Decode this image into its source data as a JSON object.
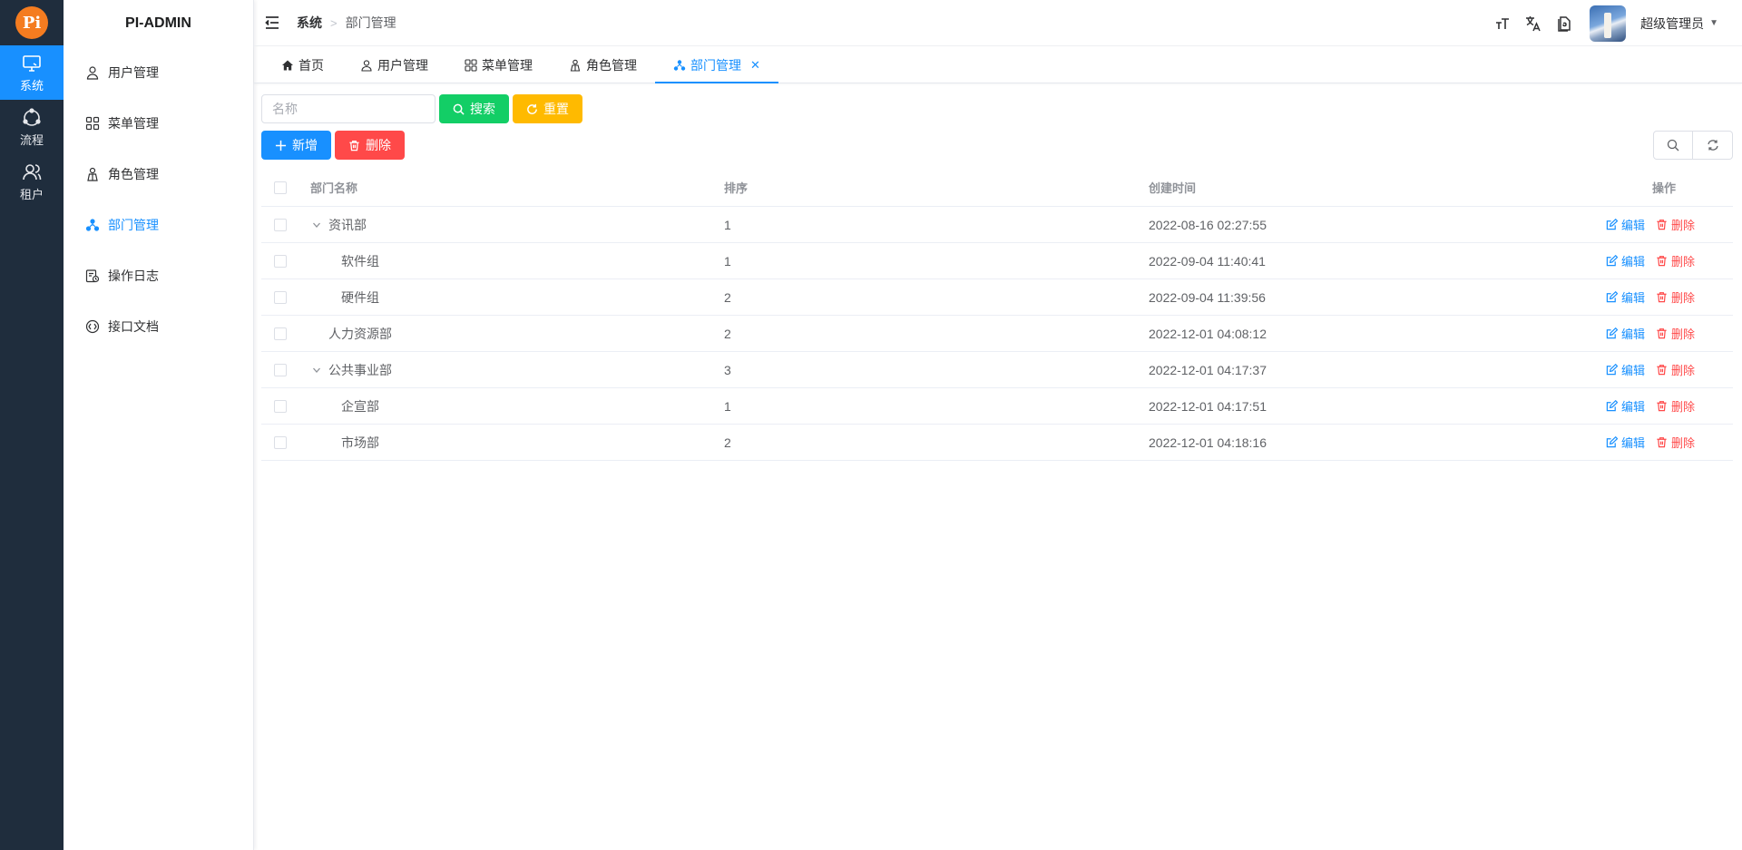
{
  "app": {
    "logo_text": "Pi",
    "brand": "PI-ADMIN"
  },
  "rail": [
    {
      "label": "系统",
      "icon": "monitor-icon",
      "active": true
    },
    {
      "label": "流程",
      "icon": "flow-icon",
      "active": false
    },
    {
      "label": "租户",
      "icon": "users-icon",
      "active": false
    }
  ],
  "menu": [
    {
      "label": "用户管理",
      "icon": "user-icon",
      "active": false
    },
    {
      "label": "菜单管理",
      "icon": "grid-icon",
      "active": false
    },
    {
      "label": "角色管理",
      "icon": "role-icon",
      "active": false
    },
    {
      "label": "部门管理",
      "icon": "org-icon",
      "active": true
    },
    {
      "label": "操作日志",
      "icon": "log-icon",
      "active": false
    },
    {
      "label": "接口文档",
      "icon": "api-icon",
      "active": false
    }
  ],
  "header": {
    "breadcrumb": [
      "系统",
      "部门管理"
    ],
    "username": "超级管理员"
  },
  "tabs": [
    {
      "label": "首页",
      "icon": "home-icon",
      "active": false
    },
    {
      "label": "用户管理",
      "icon": "user-icon",
      "active": false
    },
    {
      "label": "菜单管理",
      "icon": "grid-icon",
      "active": false
    },
    {
      "label": "角色管理",
      "icon": "role-icon",
      "active": false
    },
    {
      "label": "部门管理",
      "icon": "org-icon",
      "active": true
    }
  ],
  "search": {
    "placeholder": "名称",
    "value": "",
    "search_label": "搜索",
    "reset_label": "重置"
  },
  "toolbar": {
    "add_label": "新增",
    "delete_label": "删除"
  },
  "table": {
    "columns": [
      "部门名称",
      "排序",
      "创建时间",
      "操作"
    ],
    "rows": [
      {
        "name": "资讯部",
        "sort": "1",
        "created": "2022-08-16 02:27:55",
        "level": 0,
        "expanded": true
      },
      {
        "name": "软件组",
        "sort": "1",
        "created": "2022-09-04 11:40:41",
        "level": 1,
        "expanded": null
      },
      {
        "name": "硬件组",
        "sort": "2",
        "created": "2022-09-04 11:39:56",
        "level": 1,
        "expanded": null
      },
      {
        "name": "人力资源部",
        "sort": "2",
        "created": "2022-12-01 04:08:12",
        "level": 0,
        "expanded": null
      },
      {
        "name": "公共事业部",
        "sort": "3",
        "created": "2022-12-01 04:17:37",
        "level": 0,
        "expanded": true
      },
      {
        "name": "企宣部",
        "sort": "1",
        "created": "2022-12-01 04:17:51",
        "level": 1,
        "expanded": null
      },
      {
        "name": "市场部",
        "sort": "2",
        "created": "2022-12-01 04:18:16",
        "level": 1,
        "expanded": null
      }
    ],
    "edit_label": "编辑",
    "delete_label": "删除"
  },
  "colors": {
    "primary": "#1890ff",
    "success": "#13ce66",
    "warning": "#ffba00",
    "danger": "#ff4949",
    "rail_bg": "#1f2d3d",
    "logo": "#f47c20"
  }
}
